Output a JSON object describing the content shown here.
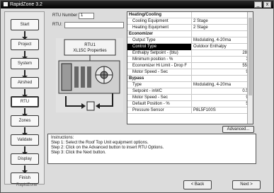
{
  "window": {
    "title": "RapidZone 3.2",
    "minimize": "_",
    "close": "x"
  },
  "sidebar": {
    "steps": [
      {
        "label": "Start"
      },
      {
        "label": "Project"
      },
      {
        "label": "System"
      },
      {
        "label": "Airshed"
      },
      {
        "label": "RTU"
      },
      {
        "label": "Zones"
      },
      {
        "label": "Validate"
      },
      {
        "label": "Display"
      },
      {
        "label": "Finish"
      }
    ],
    "active": "RTU"
  },
  "rtu_form": {
    "number_label": "RTU Number",
    "number_value": "1",
    "name_label": "RTU:",
    "name_value": ""
  },
  "equipment": {
    "title_line1": "RTU1",
    "title_line2": "XL15C Properties"
  },
  "properties": [
    {
      "label": "Heating/Cooling",
      "value": "",
      "kind": "head"
    },
    {
      "label": "Cooling Equipment",
      "value": "2 Stage",
      "kind": "sub",
      "dropdown": true
    },
    {
      "label": "Heating Equipment",
      "value": "2 Stage",
      "kind": "sub",
      "dropdown": true
    },
    {
      "label": "Economizer",
      "value": "",
      "kind": "head"
    },
    {
      "label": "Output Type",
      "value": "Modulating, 4-20ma",
      "kind": "sub",
      "dropdown": true
    },
    {
      "label": "Control Type",
      "value": "Outdoor Enthalpy",
      "kind": "sub",
      "dropdown": true,
      "selected": true
    },
    {
      "label": "Enthalpy Setpoint - (btu)",
      "value": "28.0",
      "kind": "sub"
    },
    {
      "label": "Minimum position - %",
      "value": "10",
      "kind": "sub"
    },
    {
      "label": "Economizer Hi Limit - Drop F",
      "value": "55.0",
      "kind": "sub"
    },
    {
      "label": "Motor Speed - Sec",
      "value": "90",
      "kind": "sub"
    },
    {
      "label": "Bypass",
      "value": "",
      "kind": "head"
    },
    {
      "label": "Type",
      "value": "Modulating, 4-20ma",
      "kind": "sub",
      "dropdown": true
    },
    {
      "label": "Setpoint - inWC",
      "value": "0.50",
      "kind": "sub"
    },
    {
      "label": "Motor Speed - Sec",
      "value": "90",
      "kind": "sub"
    },
    {
      "label": "Default Position - %",
      "value": "50",
      "kind": "sub"
    },
    {
      "label": "Pressure Sensor",
      "value": "P8L5F100S",
      "kind": "sub",
      "dropdown": true
    }
  ],
  "advanced_button": "Advanced...",
  "instructions": {
    "title": "Instructions:",
    "lines": [
      "Step 1: Select the Roof Top Unit equipment options.",
      "Step 2: Click on the Advanced button to insert RTU Options.",
      "Step 3: Click the Next button."
    ]
  },
  "footer": {
    "brand": "RapidZone",
    "back": "< Back",
    "next": "Next >"
  }
}
